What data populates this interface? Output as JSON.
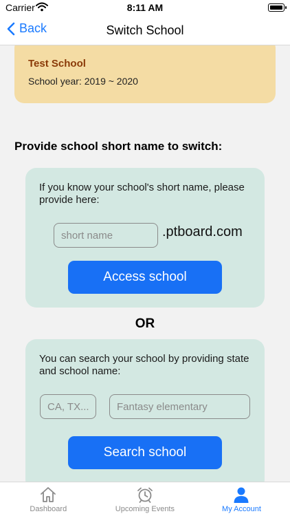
{
  "status_bar": {
    "carrier": "Carrier",
    "time": "8:11 AM"
  },
  "nav": {
    "back_label": "Back",
    "title": "Switch School"
  },
  "current_school": {
    "name": "Test School",
    "year": "School year: 2019 ~ 2020"
  },
  "switch": {
    "heading": "Provide school short name to switch:",
    "short_name": {
      "instructions": "If you know your school's short name, please provide here:",
      "input_placeholder": "short name",
      "domain_suffix": ".ptboard.com",
      "button_label": "Access school"
    },
    "or_label": "OR",
    "search": {
      "instructions": "You can search your school by providing state and school name:",
      "state_placeholder": "CA, TX...",
      "school_placeholder": "Fantasy elementary",
      "button_label": "Search school"
    }
  },
  "tabs": [
    {
      "label": "Dashboard",
      "icon": "house-icon",
      "active": false
    },
    {
      "label": "Upcoming Events",
      "icon": "alarm-clock-icon",
      "active": false
    },
    {
      "label": "My Account",
      "icon": "person-icon",
      "active": true
    }
  ],
  "colors": {
    "accent": "#1a7aff",
    "button": "#1870f5",
    "school_card": "#f4dca4",
    "school_name": "#8a3a08",
    "panel": "#d3e8e2",
    "inactive_tab": "#8a8a8a"
  }
}
